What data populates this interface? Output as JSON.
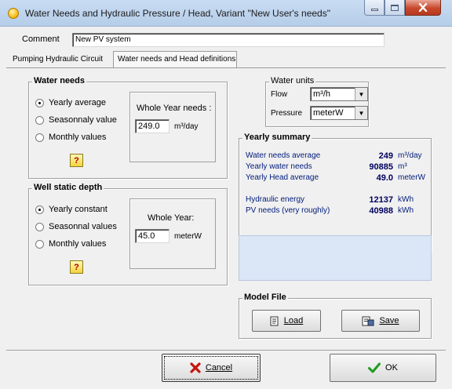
{
  "window": {
    "title": "Water Needs and Hydraulic Pressure / Head, Variant  \"New User's needs\""
  },
  "comment": {
    "label": "Comment",
    "value": "New PV system"
  },
  "tabs": [
    {
      "label": "Pumping Hydraulic Circuit"
    },
    {
      "label": "Water needs and Head definitions"
    }
  ],
  "water_needs": {
    "title": "Water needs",
    "options": [
      "Yearly average",
      "Seasonnaly value",
      "Monthly values"
    ],
    "selected": 0,
    "box_label": "Whole Year needs :",
    "value": "249.0",
    "unit": "m³/day",
    "help": "?"
  },
  "well_depth": {
    "title": "Well static depth",
    "options": [
      "Yearly constant",
      "Seasonnal values",
      "Monthly values"
    ],
    "selected": 0,
    "box_label": "Whole Year:",
    "value": "45.0",
    "unit": "meterW",
    "help": "?"
  },
  "water_units": {
    "title": "Water units",
    "flow_label": "Flow",
    "flow_value": "m³/h",
    "pressure_label": "Pressure",
    "pressure_value": "meterW"
  },
  "yearly_summary": {
    "title": "Yearly summary",
    "rows": [
      {
        "label": "Water needs average",
        "value": "249",
        "unit": "m³/day"
      },
      {
        "label": "Yearly water needs",
        "value": "90885",
        "unit": "m³"
      },
      {
        "label": "Yearly Head average",
        "value": "49.0",
        "unit": "meterW"
      },
      {
        "label": "Hydraulic energy",
        "value": "12137",
        "unit": "kWh"
      },
      {
        "label": "PV needs (very roughly)",
        "value": "40988",
        "unit": "kWh"
      }
    ]
  },
  "model_file": {
    "title": "Model File",
    "load_label": "Load",
    "save_label": "Save"
  },
  "footer": {
    "cancel_label": "Cancel",
    "ok_label": "OK"
  },
  "colors": {
    "info_panel": "#dbe6f6",
    "summary_text": "#001b7a",
    "cancel_icon": "#c4160f",
    "ok_icon": "#1f9a1f"
  }
}
